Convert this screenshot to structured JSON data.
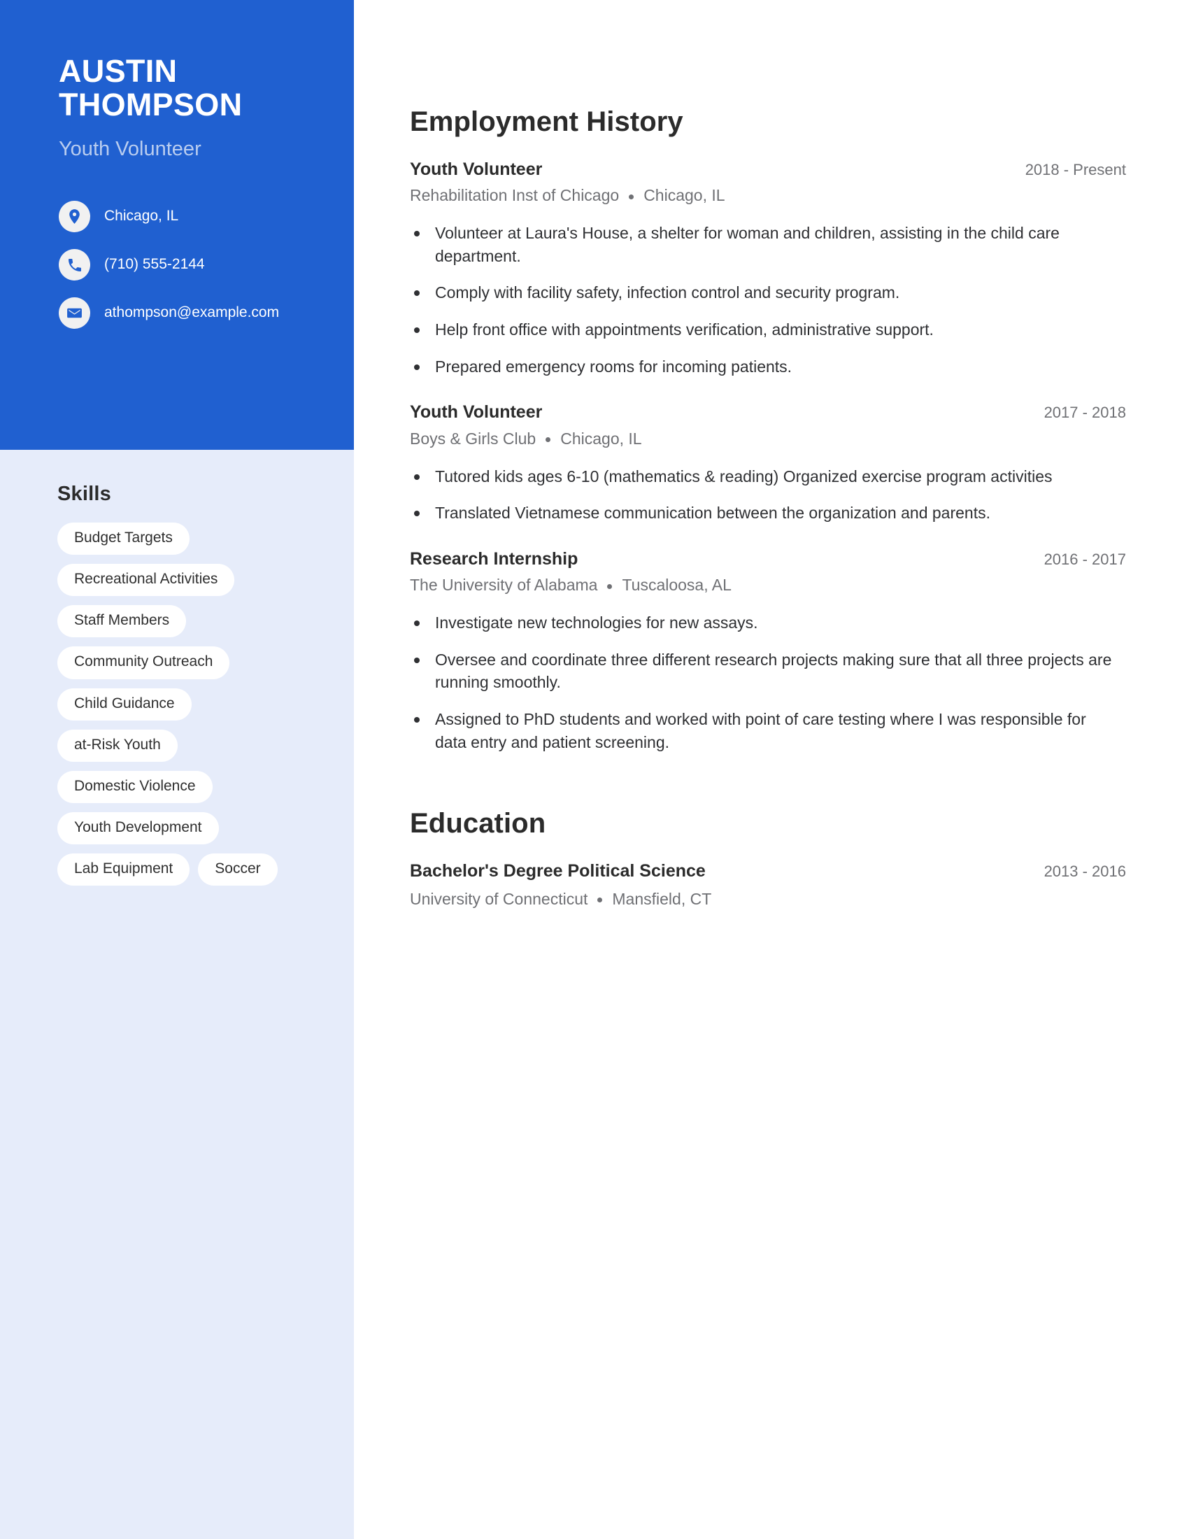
{
  "colors": {
    "primary_blue": "#2060d0",
    "sidebar_light": "#e6ecfa",
    "chip_white": "#ffffff",
    "muted_text": "#6f7074",
    "body_text": "#2f3033",
    "subtitle_blue": "#b9cdf0"
  },
  "profile": {
    "first_name": "AUSTIN",
    "last_name": "THOMPSON",
    "job_title": "Youth Volunteer",
    "contacts": [
      {
        "icon": "location-pin-icon",
        "value": "Chicago, IL"
      },
      {
        "icon": "phone-icon",
        "value": "(710) 555-2144"
      },
      {
        "icon": "envelope-icon",
        "value": "athompson@example.com"
      }
    ]
  },
  "skills": {
    "title": "Skills",
    "items": [
      "Budget Targets",
      "Recreational Activities",
      "Staff Members",
      "Community Outreach",
      "Child Guidance",
      "at-Risk Youth",
      "Domestic Violence",
      "Youth Development",
      "Lab Equipment",
      "Soccer"
    ]
  },
  "employment": {
    "title": "Employment History",
    "entries": [
      {
        "role": "Youth Volunteer",
        "dates": "2018 - Present",
        "company": "Rehabilitation Inst of Chicago",
        "location": "Chicago, IL",
        "bullets": [
          "Volunteer at Laura's House, a shelter for woman and children, assisting in the child care department.",
          "Comply with facility safety, infection control and security program.",
          "Help front office with appointments verification, administrative support.",
          "Prepared emergency rooms for incoming patients."
        ]
      },
      {
        "role": "Youth Volunteer",
        "dates": "2017 - 2018",
        "company": "Boys & Girls Club",
        "location": "Chicago, IL",
        "bullets": [
          "Tutored kids ages 6-10 (mathematics & reading) Organized exercise program activities",
          "Translated Vietnamese communication between the organization and parents."
        ]
      },
      {
        "role": "Research Internship",
        "dates": "2016 - 2017",
        "company": "The University of Alabama",
        "location": "Tuscaloosa, AL",
        "bullets": [
          "Investigate new technologies for new assays.",
          "Oversee and coordinate three different research projects making sure that all three projects are running smoothly.",
          "Assigned to PhD students and worked with point of care testing where I was responsible for data entry and patient screening."
        ]
      }
    ]
  },
  "education": {
    "title": "Education",
    "entries": [
      {
        "degree": "Bachelor's Degree Political Science",
        "dates": "2013 - 2016",
        "school": "University of Connecticut",
        "location": "Mansfield, CT"
      }
    ]
  }
}
